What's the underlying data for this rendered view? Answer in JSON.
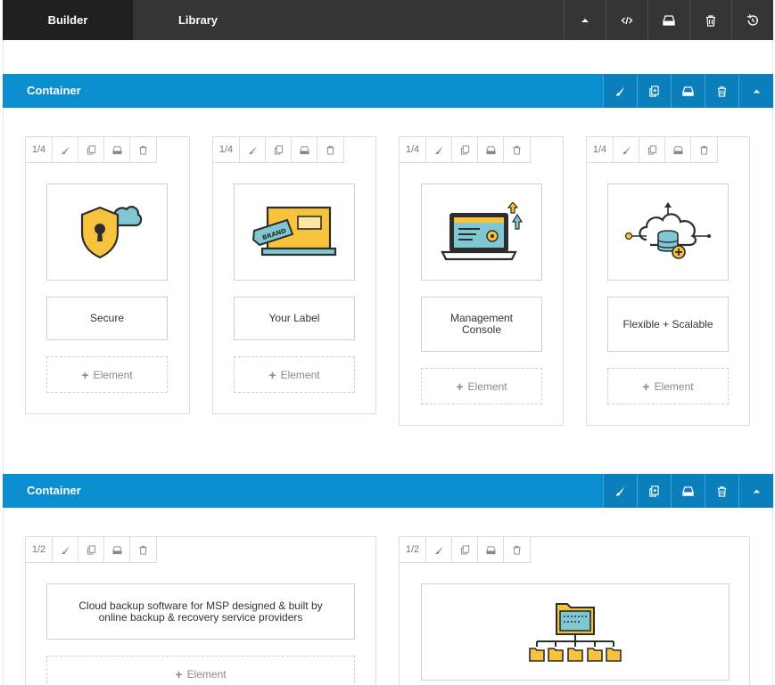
{
  "tabs": {
    "builder": "Builder",
    "library": "Library"
  },
  "toolbar_icons": [
    "chevron-up-icon",
    "code-icon",
    "save-icon",
    "trash-icon",
    "history-icon"
  ],
  "containers": [
    {
      "title": "Container",
      "columns": [
        {
          "size": "1/4",
          "image": "shield-lock-cloud-illustration",
          "text": "Secure",
          "add_label": "Element"
        },
        {
          "size": "1/4",
          "image": "brand-label-laptop-illustration",
          "text": "Your Label",
          "add_label": "Element"
        },
        {
          "size": "1/4",
          "image": "laptop-console-illustration",
          "text": "Management Console",
          "add_label": "Element"
        },
        {
          "size": "1/4",
          "image": "cloud-database-illustration",
          "text": "Flexible + Scalable",
          "add_label": "Element"
        }
      ]
    },
    {
      "title": "Container",
      "columns": [
        {
          "size": "1/2",
          "text": "Cloud backup software for MSP designed & built by online backup & recovery service providers",
          "add_label": "Element"
        },
        {
          "size": "1/2",
          "image": "folder-tree-illustration"
        }
      ]
    }
  ],
  "colors": {
    "topbar": "#333538",
    "active_tab": "#1f2022",
    "container_bar": "#0b8ecf",
    "accent_yellow": "#f8c33c",
    "accent_teal": "#7fc7d3"
  }
}
